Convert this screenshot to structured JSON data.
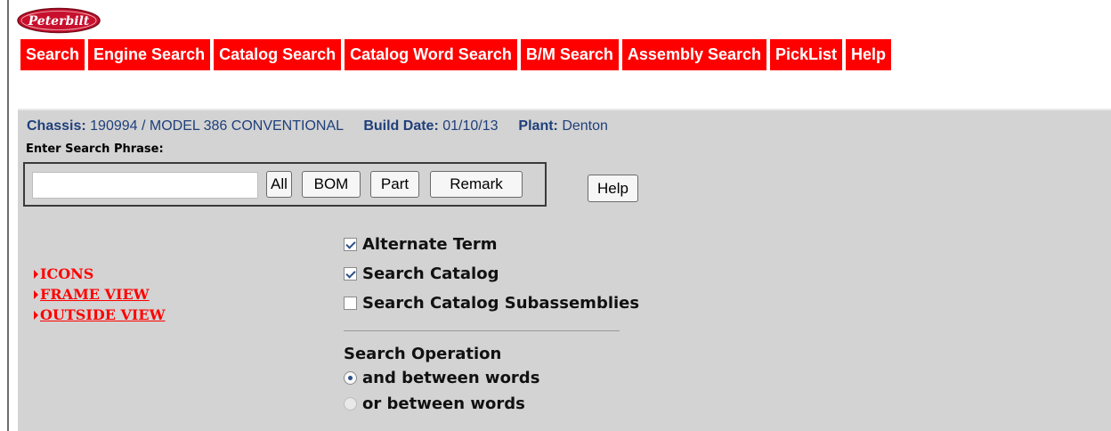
{
  "brand": {
    "logo_text": "Peterbilt",
    "color": "#c8102e"
  },
  "nav": {
    "items": [
      {
        "label": "Search"
      },
      {
        "label": "Engine Search"
      },
      {
        "label": "Catalog Search"
      },
      {
        "label": "Catalog Word Search"
      },
      {
        "label": "B/M Search"
      },
      {
        "label": "Assembly Search"
      },
      {
        "label": "PickList"
      },
      {
        "label": "Help"
      }
    ],
    "bg_color": "#ff0000"
  },
  "header": {
    "chassis_label": "Chassis:",
    "chassis_value": "190994  / MODEL 386 CONVENTIONAL",
    "build_label": "Build Date:",
    "build_value": "01/10/13",
    "plant_label": "Plant:",
    "plant_value": "Denton"
  },
  "search": {
    "phrase_label": "Enter Search Phrase:",
    "input_value": "",
    "input_placeholder": "",
    "buttons": {
      "all": "All",
      "bom": "BOM",
      "part": "Part",
      "remark": "Remark"
    },
    "help": "Help"
  },
  "links": [
    {
      "label": "ICONS"
    },
    {
      "label": " FRAME VIEW"
    },
    {
      "label": " OUTSIDE VIEW"
    }
  ],
  "options": {
    "checkboxes": [
      {
        "label": "Alternate Term",
        "checked": true
      },
      {
        "label": "Search Catalog",
        "checked": true
      },
      {
        "label": "Search Catalog Subassemblies",
        "checked": false
      }
    ],
    "operation_title": "Search Operation",
    "radios": [
      {
        "label": "and between words",
        "checked": true
      },
      {
        "label": "or between words",
        "checked": false
      }
    ]
  }
}
